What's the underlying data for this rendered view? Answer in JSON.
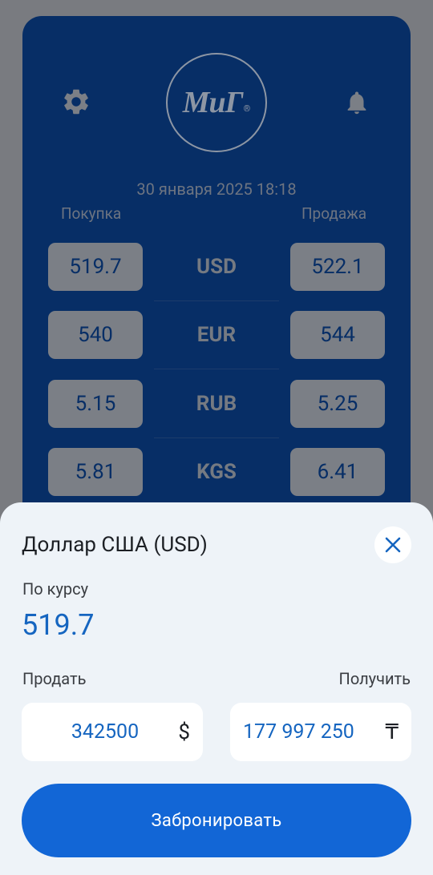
{
  "logo": {
    "text": "МиГ",
    "reg_mark": "®"
  },
  "datetime": "30 января 2025 18:18",
  "columns": {
    "buy": "Покупка",
    "sell": "Продажа"
  },
  "rates": [
    {
      "code": "USD",
      "buy": "519.7",
      "sell": "522.1"
    },
    {
      "code": "EUR",
      "buy": "540",
      "sell": "544"
    },
    {
      "code": "RUB",
      "buy": "5.15",
      "sell": "5.25"
    },
    {
      "code": "KGS",
      "buy": "5.81",
      "sell": "6.41"
    }
  ],
  "sheet": {
    "title": "Доллар США (USD)",
    "rate_label": "По курсу",
    "rate_value": "519.7",
    "sell_label": "Продать",
    "get_label": "Получить",
    "sell_amount": "342500",
    "sell_currency_sign": "$",
    "get_amount": "177 997 250",
    "get_currency_sign": "₸",
    "book_button": "Забронировать"
  },
  "icons": {
    "settings": "gear-icon",
    "notifications": "bell-icon",
    "close": "close-icon"
  },
  "colors": {
    "overlay": "#797b80",
    "card": "#072e66",
    "sheet": "#eef3f8",
    "accent": "#1266d6",
    "value_blue": "#1565c0"
  }
}
